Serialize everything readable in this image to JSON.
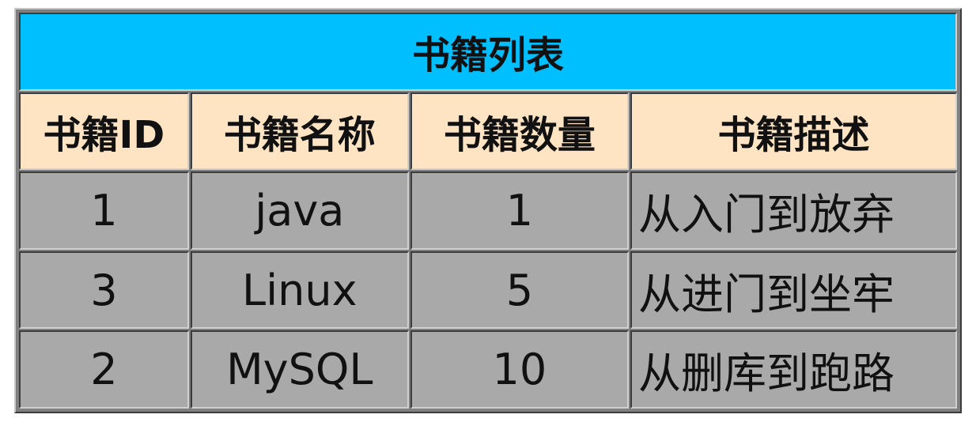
{
  "table": {
    "title": "书籍列表",
    "columns": [
      "书籍ID",
      "书籍名称",
      "书籍数量",
      "书籍描述"
    ],
    "rows": [
      {
        "id": "1",
        "name": "java",
        "count": "1",
        "desc": "从入门到放弃"
      },
      {
        "id": "3",
        "name": "Linux",
        "count": "5",
        "desc": "从进门到坐牢"
      },
      {
        "id": "2",
        "name": "MySQL",
        "count": "10",
        "desc": "从删库到跑路"
      }
    ]
  },
  "colors": {
    "title_bg": "#00bfff",
    "header_bg": "#ffe4c4",
    "row_bg": "#a9a9a9",
    "outer_border": "#7f7f7f"
  }
}
